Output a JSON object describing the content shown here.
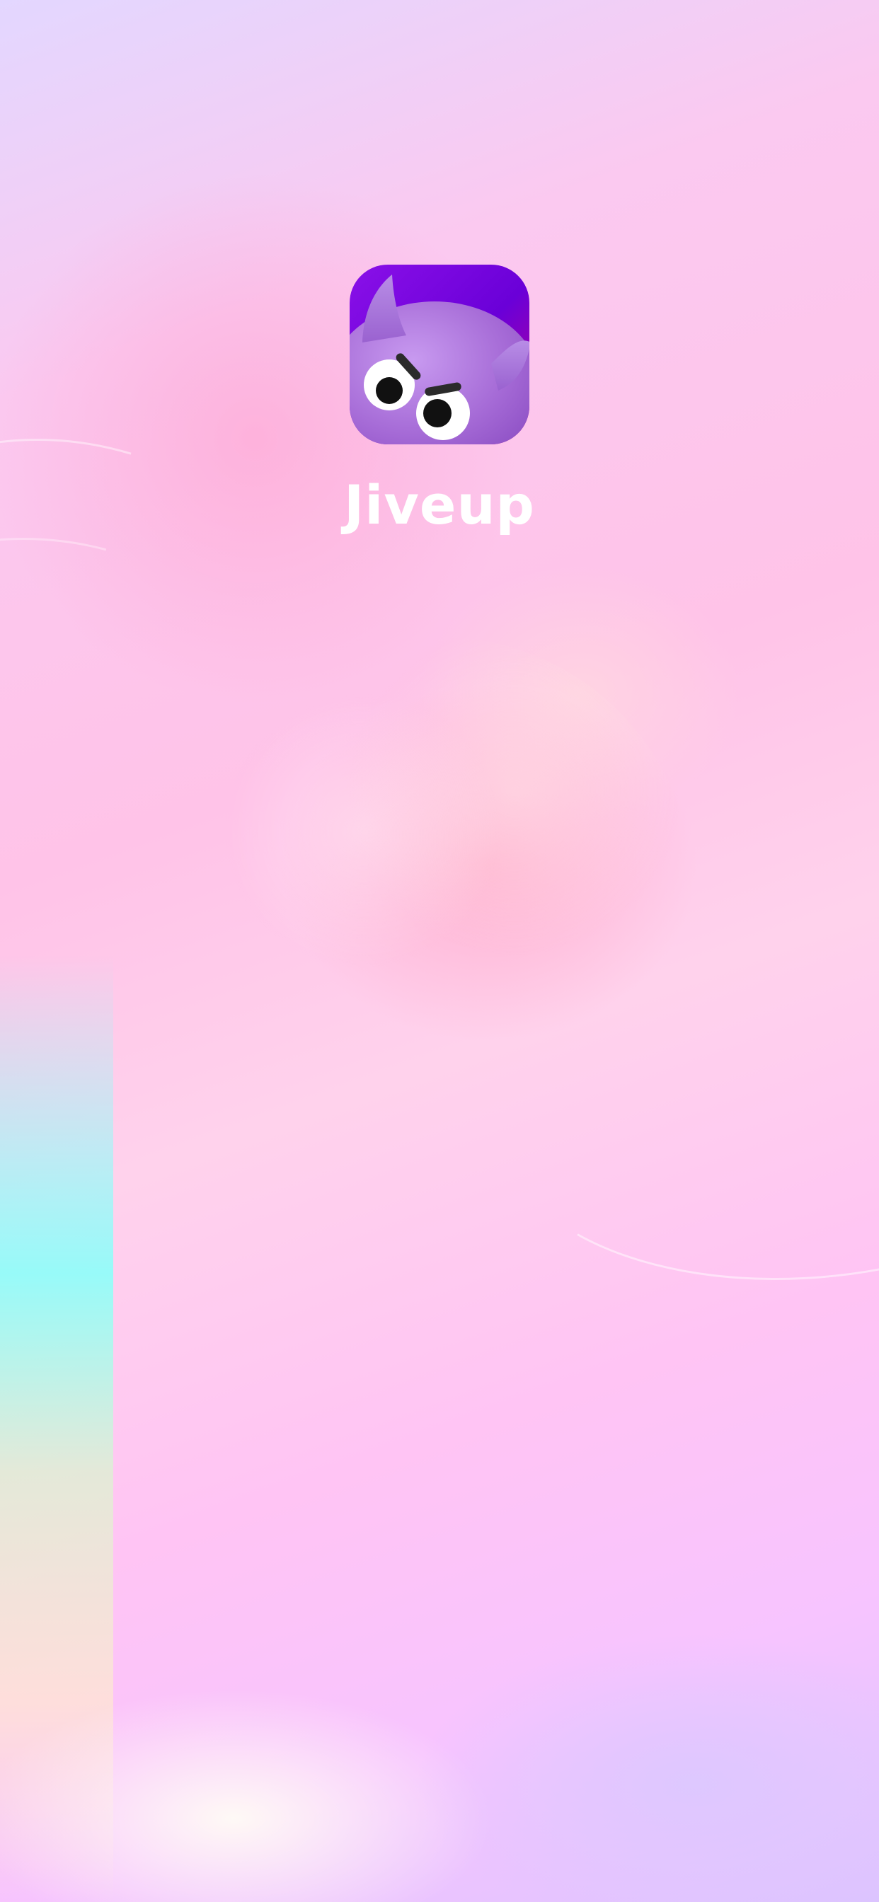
{
  "splash": {
    "app_name": "Jiveup",
    "logo_icon": "purple-devil-mascot-icon"
  },
  "colors": {
    "icon_bg_primary": "#6a00d8",
    "icon_bg_accent": "#c0008e",
    "mascot_purple": "#a86ad8",
    "title_text": "#ffffff"
  }
}
